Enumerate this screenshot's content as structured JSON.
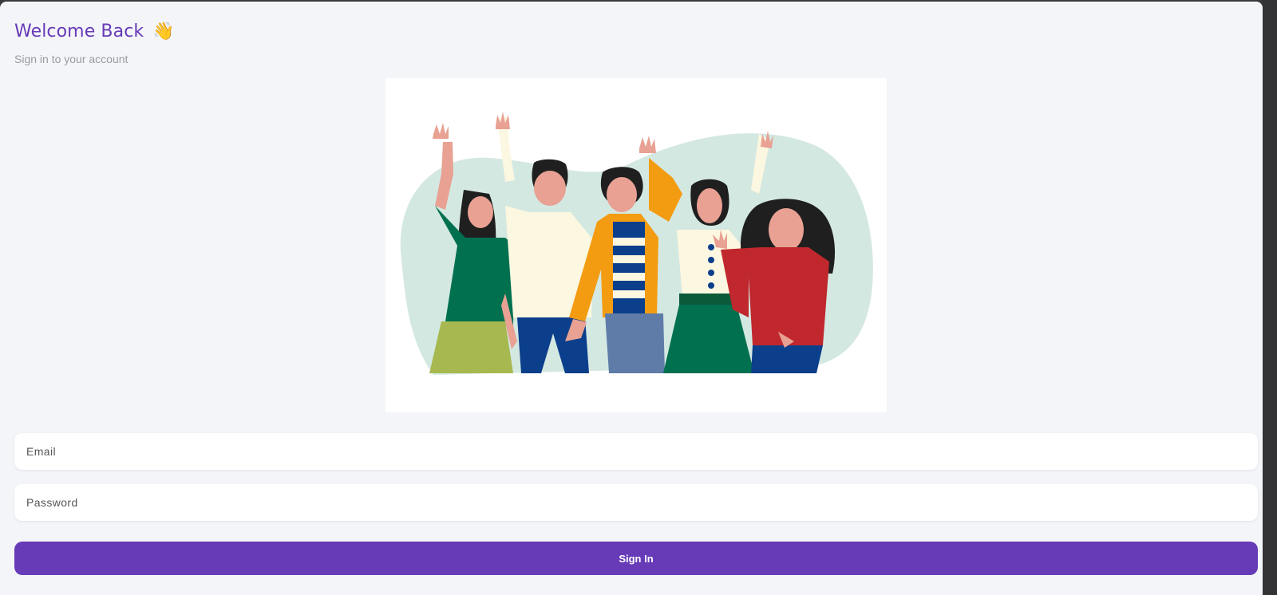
{
  "header": {
    "title": "Welcome Back",
    "emoji": "👋",
    "subtitle": "Sign in to your account"
  },
  "form": {
    "email_placeholder": "Email",
    "password_placeholder": "Password",
    "submit_label": "Sign In"
  },
  "colors": {
    "accent": "#673ab7",
    "background": "#f4f5f9"
  },
  "illustration": {
    "icon": "waving-people-illustration"
  }
}
